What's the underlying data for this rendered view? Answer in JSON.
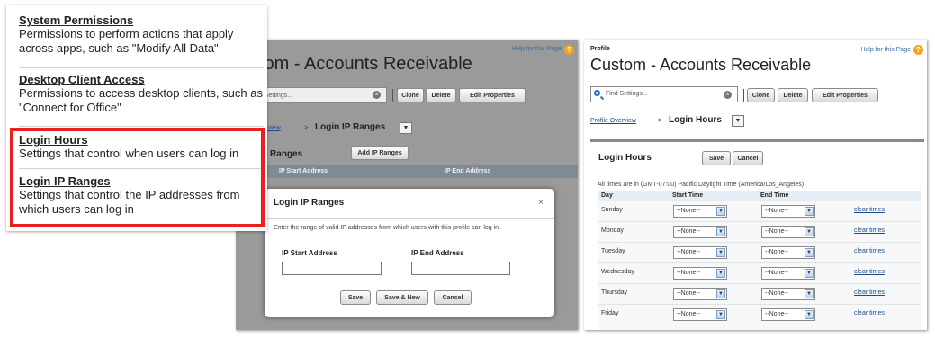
{
  "callout": {
    "items": [
      {
        "heading": "System Permissions",
        "desc": "Permissions to perform actions that apply across apps, such as \"Modify All Data\""
      },
      {
        "heading": "Desktop Client Access",
        "desc": "Permissions to access desktop clients, such as \"Connect for Office\""
      },
      {
        "heading": "Login Hours",
        "desc": "Settings that control when users can log in"
      },
      {
        "heading": "Login IP Ranges",
        "desc": "Settings that control the IP addresses from which users can log in"
      }
    ],
    "highlight_color": "#e8201e"
  },
  "mid": {
    "help": "Help for this Page",
    "title": "tom - Accounts Receivable",
    "search_placeholder": "d Settings...",
    "buttons": {
      "clone": "Clone",
      "delete": "Delete",
      "edit": "Edit Properties"
    },
    "crumb_link": "verview",
    "crumb_sep": ">",
    "crumb_current": "Login IP Ranges",
    "section_title": "IP Ranges",
    "add_button": "Add IP Ranges",
    "col_start": "IP Start Address",
    "col_end": "IP End Address",
    "modal": {
      "title": "Login IP Ranges",
      "close": "×",
      "description": "Enter the range of valid IP addresses from which users with this profile can log in.",
      "start_label": "IP Start Address",
      "end_label": "IP End Address",
      "save": "Save",
      "save_new": "Save & New",
      "cancel": "Cancel"
    }
  },
  "right": {
    "eyebrow": "Profile",
    "help": "Help for this Page",
    "title": "Custom - Accounts Receivable",
    "search_placeholder": "Find Settings...",
    "buttons": {
      "clone": "Clone",
      "delete": "Delete",
      "edit": "Edit Properties"
    },
    "crumb_link": "Profile Overview",
    "crumb_sep": ">",
    "crumb_current": "Login Hours",
    "section_title": "Login Hours",
    "save": "Save",
    "cancel": "Cancel",
    "timezone_note": "All times are in (GMT-07:00) Pacific Daylight Time (America/Los_Angeles)",
    "col_day": "Day",
    "col_start": "Start Time",
    "col_end": "End Time",
    "rows": [
      {
        "day": "Sunday",
        "start": "--None--",
        "end": "--None--",
        "clear": "clear times"
      },
      {
        "day": "Monday",
        "start": "--None--",
        "end": "--None--",
        "clear": "clear times"
      },
      {
        "day": "Tuesday",
        "start": "--None--",
        "end": "--None--",
        "clear": "clear times"
      },
      {
        "day": "Wednesday",
        "start": "--None--",
        "end": "--None--",
        "clear": "clear times"
      },
      {
        "day": "Thursday",
        "start": "--None--",
        "end": "--None--",
        "clear": "clear times"
      },
      {
        "day": "Friday",
        "start": "--None--",
        "end": "--None--",
        "clear": "clear times"
      }
    ]
  }
}
